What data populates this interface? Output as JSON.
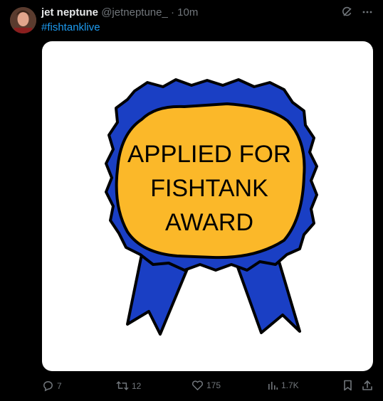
{
  "tweet": {
    "display_name": "jet neptune",
    "handle": "@jetneptune_",
    "separator": "·",
    "time": "10m",
    "hashtag": "#fishtanklive"
  },
  "media": {
    "lines": [
      "APPLIED FOR",
      "FISHTANK",
      "AWARD"
    ],
    "ribbon_color": "#1a3fc4",
    "badge_color": "#fbb829"
  },
  "actions": {
    "replies": "7",
    "reposts": "12",
    "likes": "175",
    "views": "1.7K"
  },
  "icons": [
    "grok-icon",
    "more-icon",
    "reply-icon",
    "repost-icon",
    "like-icon",
    "views-icon",
    "bookmark-icon",
    "share-icon"
  ]
}
